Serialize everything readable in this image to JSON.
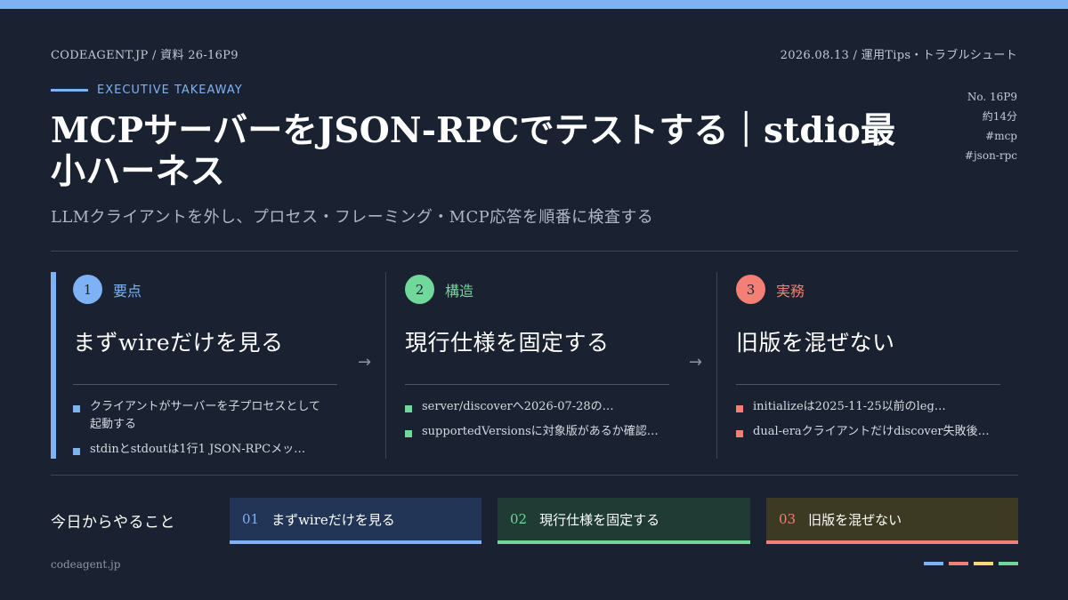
{
  "header": {
    "site": "CODEAGENT.JP",
    "separator": "/",
    "doc_id": "資料 26-16P9",
    "date": "2026.08.13",
    "category": "運用Tips・トラブルシュート"
  },
  "eyebrow": "EXECUTIVE TAKEAWAY",
  "title": "MCPサーバーをJSON-RPCでテストする｜stdio最小ハーネス",
  "subtitle": "LLMクライアントを外し、プロセス・フレーミング・MCP応答を順番に検査する",
  "side_meta": {
    "number": "No. 16P9",
    "duration": "約14分",
    "tags": [
      "#mcp",
      "#json-rpc"
    ]
  },
  "columns": [
    {
      "num": "1",
      "label": "要点",
      "heading": "まずwireだけを見る",
      "bullets": [
        "クライアントがサーバーを子プロセスとして起動する",
        "stdinとstdoutは1行1 JSON-RPCメッ…"
      ]
    },
    {
      "num": "2",
      "label": "構造",
      "heading": "現行仕様を固定する",
      "bullets": [
        "server/discoverへ2026-07-28の…",
        "supportedVersionsに対象版があるか確認…"
      ]
    },
    {
      "num": "3",
      "label": "実務",
      "heading": "旧版を混ぜない",
      "bullets": [
        "initializeは2025-11-25以前のleg…",
        "dual-eraクライアントだけdiscover失敗後…"
      ]
    }
  ],
  "arrow_glyph": "→",
  "today": {
    "label": "今日からやること",
    "actions": [
      {
        "num": "01",
        "text": "まずwireだけを見る"
      },
      {
        "num": "02",
        "text": "現行仕様を固定する"
      },
      {
        "num": "03",
        "text": "旧版を混ぜない"
      }
    ]
  },
  "footer": "codeagent.jp",
  "colors": {
    "background": "#1a2231",
    "blue": "#7fb2f5",
    "green": "#6fd89a",
    "red": "#f47f74",
    "yellow": "#f5d97a"
  }
}
